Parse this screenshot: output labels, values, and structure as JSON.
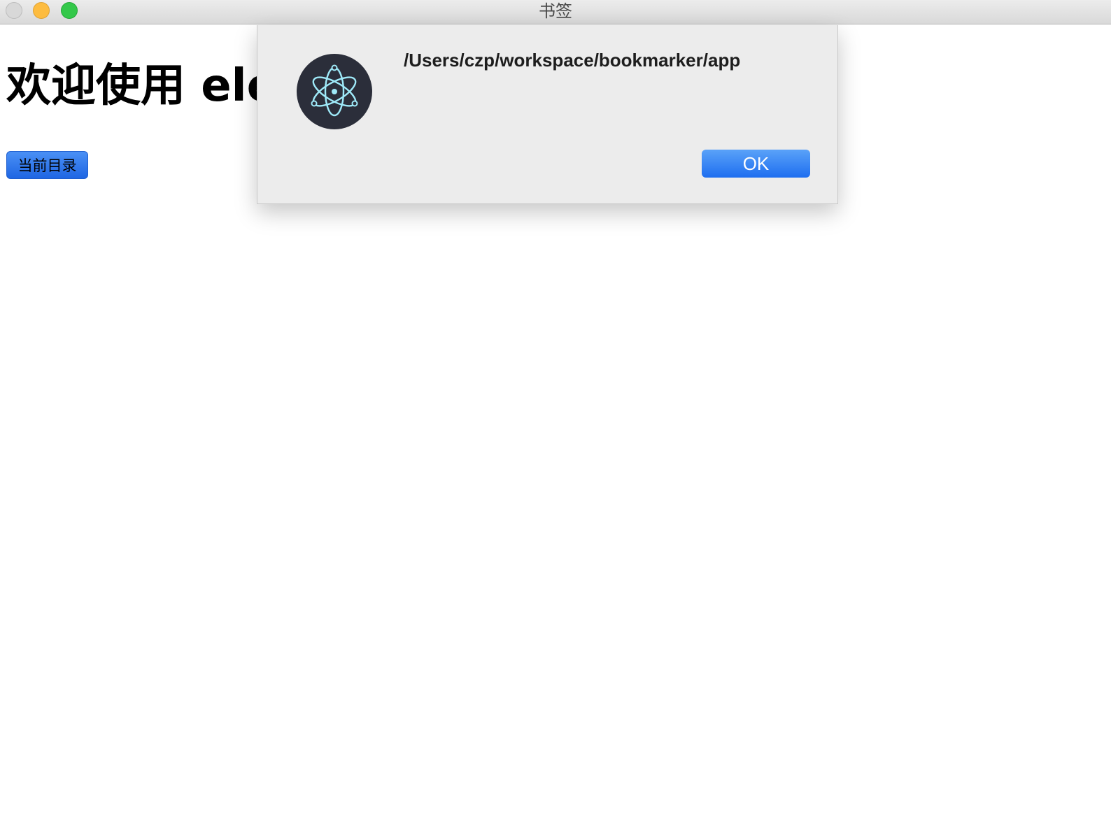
{
  "window": {
    "title": "书签"
  },
  "page": {
    "heading": "欢迎使用 electron",
    "current_dir_button": "当前目录"
  },
  "dialog": {
    "icon": "electron-app-icon",
    "message": "/Users/czp/workspace/bookmarker/app",
    "ok_label": "OK"
  },
  "colors": {
    "accent": "#1e6ef0",
    "icon_bg": "#2b2e3a",
    "icon_fg": "#9feaf9"
  }
}
